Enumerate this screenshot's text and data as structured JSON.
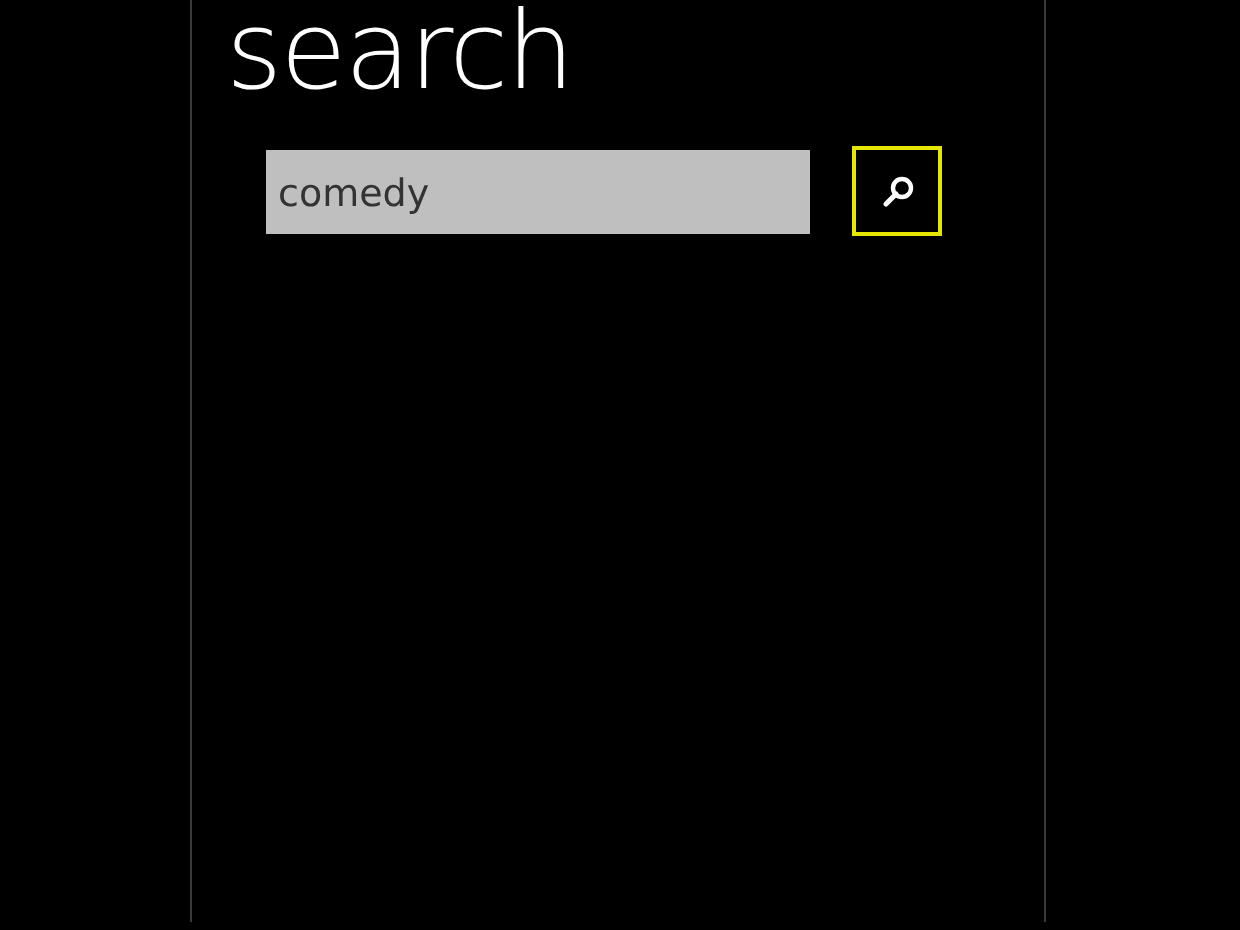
{
  "page": {
    "title": "search"
  },
  "search_field": {
    "value": "comedy"
  },
  "search_button": {
    "focused": true
  }
}
